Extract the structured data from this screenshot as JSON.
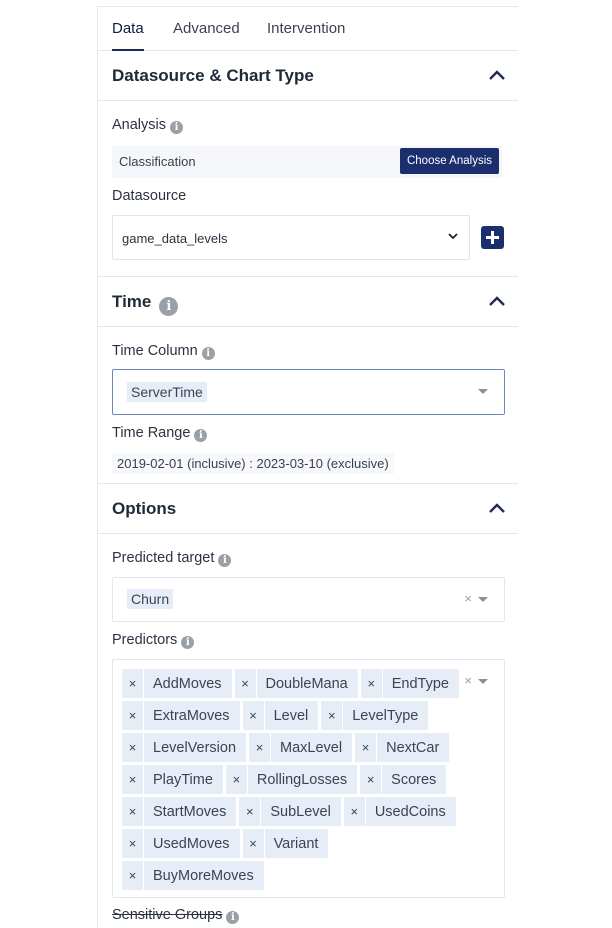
{
  "tabs": [
    {
      "label": "Data",
      "active": true
    },
    {
      "label": "Advanced",
      "active": false
    },
    {
      "label": "Intervention",
      "active": false
    }
  ],
  "sections": {
    "datasource": {
      "title": "Datasource & Chart Type",
      "analysis_label": "Analysis",
      "analysis_value": "Classification",
      "choose_button": "Choose Analysis",
      "datasource_label": "Datasource",
      "datasource_value": "game_data_levels"
    },
    "time": {
      "title": "Time",
      "time_column_label": "Time Column",
      "time_column_value": "ServerTime",
      "time_range_label": "Time Range",
      "time_range_value": "2019-02-01 (inclusive) : 2023-03-10 (exclusive)"
    },
    "options": {
      "title": "Options",
      "predicted_target_label": "Predicted target",
      "predicted_target_value": "Churn",
      "predictors_label": "Predictors",
      "predictors": [
        [
          "AddMoves",
          "DoubleMana",
          "EndType"
        ],
        [
          "ExtraMoves",
          "Level",
          "LevelType"
        ],
        [
          "LevelVersion",
          "MaxLevel",
          "NextCar"
        ],
        [
          "PlayTime",
          "RollingLosses",
          "Scores"
        ],
        [
          "StartMoves",
          "SubLevel",
          "UsedCoins"
        ],
        [
          "UsedMoves",
          "Variant"
        ],
        [
          "BuyMoreMoves"
        ]
      ],
      "sensitive_groups_label": "Sensitive Groups"
    }
  },
  "glyphs": {
    "remove": "×",
    "info": "i"
  },
  "colors": {
    "primary": "#1b2f6e",
    "chip_bg": "#e7edf6",
    "border": "#e3e5e9"
  }
}
